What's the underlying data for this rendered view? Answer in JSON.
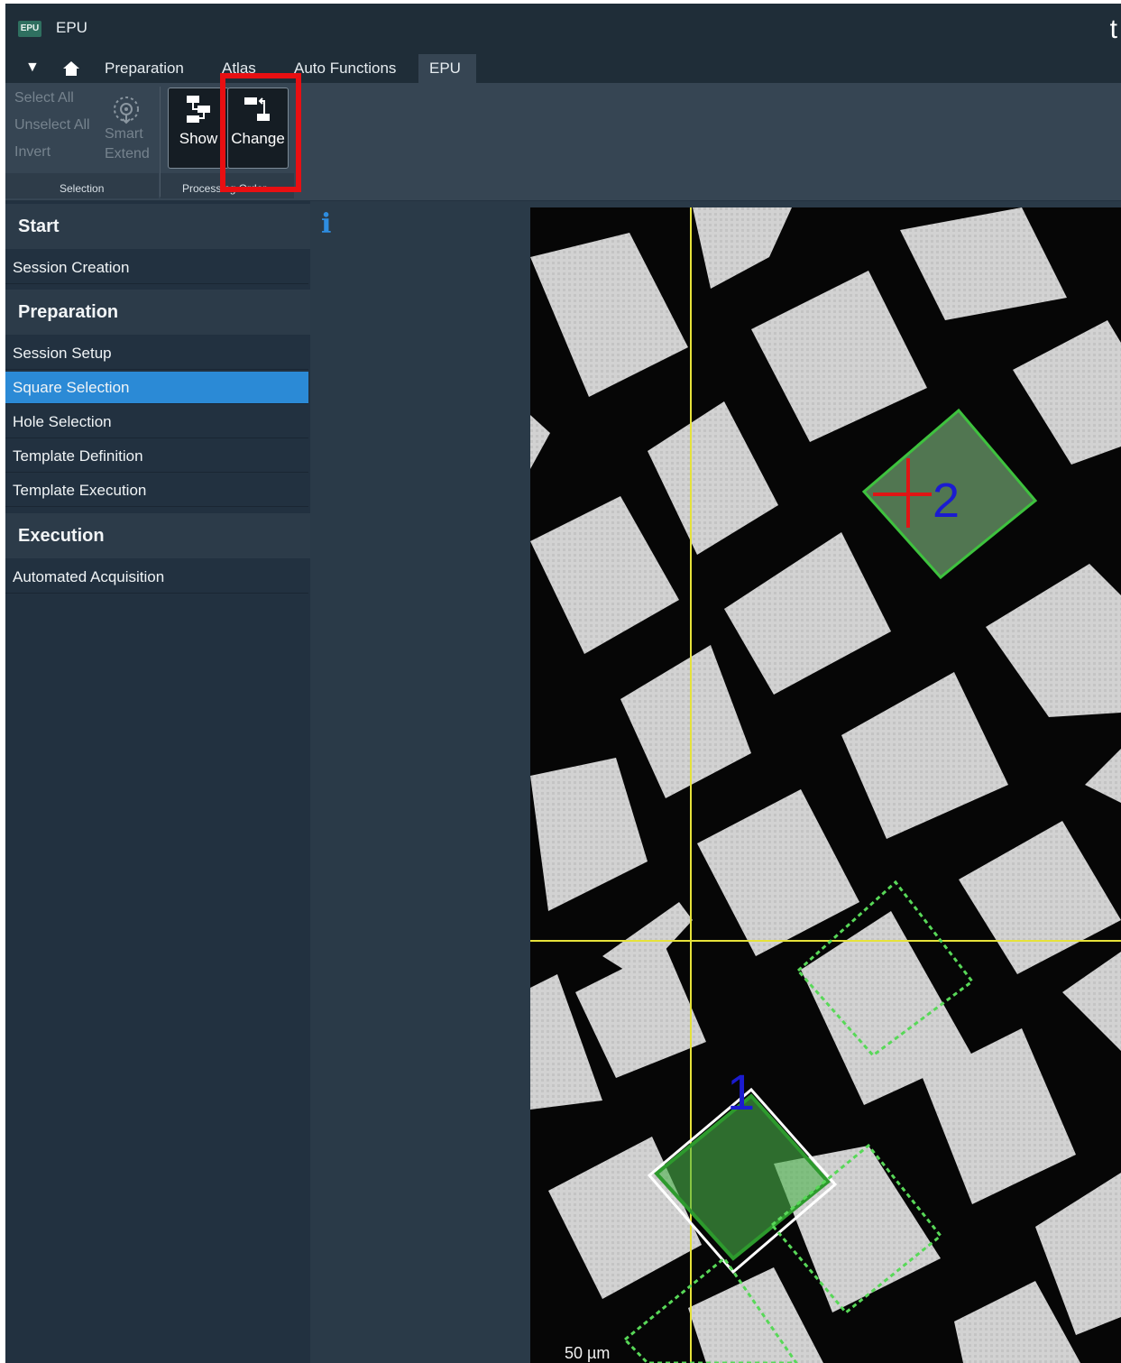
{
  "app": {
    "logo_text": "EPU",
    "title": "EPU",
    "corner_letter": "t"
  },
  "tabs": [
    {
      "label": "Preparation"
    },
    {
      "label": "Atlas"
    },
    {
      "label": "Auto Functions"
    },
    {
      "label": "EPU"
    }
  ],
  "ribbon": {
    "selection_group": {
      "select_all": "Select All",
      "unselect_all": "Unselect All",
      "invert": "Invert",
      "smart_extend_line1": "Smart",
      "smart_extend_line2": "Extend",
      "label": "Selection"
    },
    "processing_order_group": {
      "show_label": "Show",
      "change_label": "Change",
      "label": "Processing Order"
    }
  },
  "sidebar": {
    "sections": [
      {
        "title": "Start",
        "items": [
          "Session Creation"
        ]
      },
      {
        "title": "Preparation",
        "items": [
          "Session Setup",
          "Square Selection",
          "Hole Selection",
          "Template Definition",
          "Template Execution"
        ]
      },
      {
        "title": "Execution",
        "items": [
          "Automated Acquisition"
        ]
      }
    ],
    "selected_item": "Square Selection"
  },
  "viewer": {
    "info_icon": "info-icon",
    "marker_1": "1",
    "marker_2": "2",
    "scale_bar": "50 µm"
  },
  "colors": {
    "selected_blue": "#2b8ad6",
    "highlight_red": "#e80f12",
    "crosshair_yellow": "#e6e23a",
    "selection_green": "#3ec23e",
    "marker_blue": "#1b1bd0"
  }
}
